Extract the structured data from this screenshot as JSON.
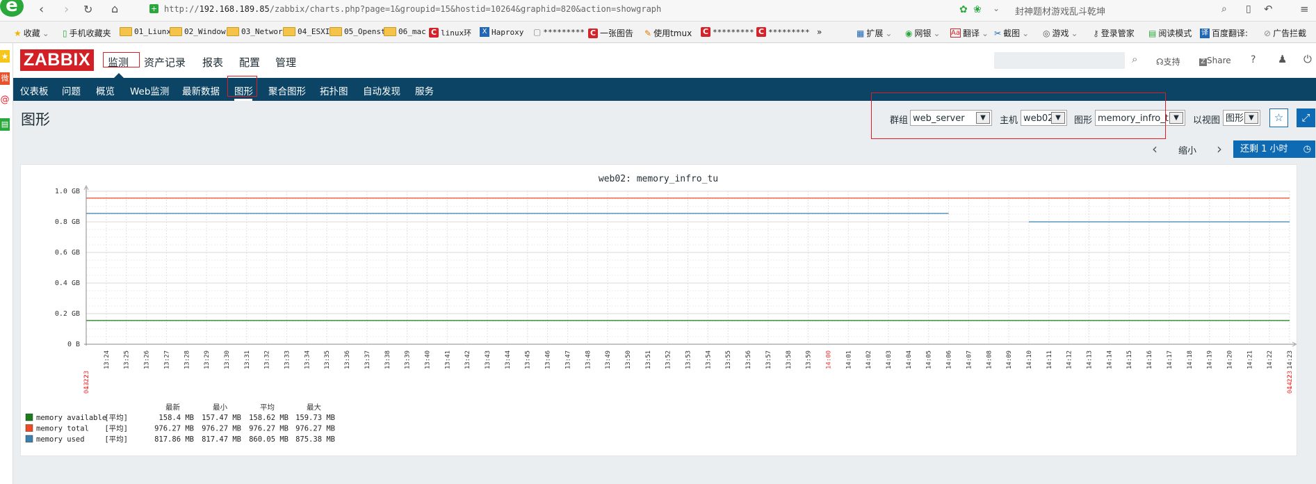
{
  "browser": {
    "url_prefix": "http://",
    "url_host": "192.168.189.85",
    "url_path": "/zabbix/charts.php?page=1&groupid=15&hostid=10264&graphid=820&action=showgraph",
    "search_hint": "封神题材游戏乱斗乾坤",
    "bookmarks": [
      "收藏",
      "手机收藏夹",
      "01_Liunx",
      "02_Window",
      "03_Networ",
      "04_ESXI",
      "05_Openst",
      "06_mac",
      "linux环",
      "Haproxy",
      "*********",
      "一张图告",
      "使用tmux",
      "*********",
      "*********",
      "»"
    ],
    "right_tools": [
      "扩展",
      "网银",
      "翻译",
      "截图",
      "游戏",
      "登录管家",
      "阅读模式",
      "百度翻译:",
      "广告拦截"
    ]
  },
  "header": {
    "logo": "ZABBIX",
    "menu": [
      "监测",
      "资产记录",
      "报表",
      "配置",
      "管理"
    ],
    "support": "支持",
    "share": "Share",
    "help": "?"
  },
  "subnav": [
    "仪表板",
    "问题",
    "概览",
    "Web监测",
    "最新数据",
    "图形",
    "聚合图形",
    "拓扑图",
    "自动发现",
    "服务"
  ],
  "page": {
    "title": "图形",
    "filters": {
      "group_label": "群组",
      "group_value": "web_server",
      "host_label": "主机",
      "host_value": "web02",
      "graph_label": "图形",
      "graph_value": "memory_infro_tu",
      "view_label": "以视图",
      "view_value": "图形"
    }
  },
  "timebar": {
    "zoom_out": "缩小",
    "range_button": "还剩 1 小时"
  },
  "chart_data": {
    "type": "line",
    "title": "web02: memory_infro_tu",
    "ylabel": "",
    "xlabel": "",
    "ylim": [
      0,
      1.0
    ],
    "yticks": [
      "0 B",
      "0.2 GB",
      "0.4 GB",
      "0.6 GB",
      "0.8 GB",
      "1.0 GB"
    ],
    "ytick_values": [
      0,
      0.2,
      0.4,
      0.6,
      0.8,
      1.0
    ],
    "x_start": "13:23",
    "x_end": "14:23",
    "x_date": "04-22",
    "x_ticks": [
      "13:24",
      "13:25",
      "13:26",
      "13:27",
      "13:28",
      "13:29",
      "13:30",
      "13:31",
      "13:32",
      "13:33",
      "13:34",
      "13:35",
      "13:36",
      "13:37",
      "13:38",
      "13:39",
      "13:40",
      "13:41",
      "13:42",
      "13:43",
      "13:44",
      "13:45",
      "13:46",
      "13:47",
      "13:48",
      "13:49",
      "13:50",
      "13:51",
      "13:52",
      "13:53",
      "13:54",
      "13:55",
      "13:56",
      "13:57",
      "13:58",
      "13:59",
      "14:00",
      "14:01",
      "14:02",
      "14:03",
      "14:04",
      "14:05",
      "14:06",
      "14:07",
      "14:08",
      "14:09",
      "14:10",
      "14:11",
      "14:12",
      "14:13",
      "14:14",
      "14:15",
      "14:16",
      "14:17",
      "14:18",
      "14:19",
      "14:20",
      "14:21",
      "14:22",
      "14:23"
    ],
    "series": [
      {
        "name": "memory available",
        "color": "#1a7c1a",
        "segments": [
          {
            "x": [
              "13:23",
              "14:23"
            ],
            "y": [
              0.155,
              0.155
            ]
          }
        ]
      },
      {
        "name": "memory total",
        "color": "#f04a25",
        "segments": [
          {
            "x": [
              "13:23",
              "14:23"
            ],
            "y": [
              0.955,
              0.955
            ]
          }
        ]
      },
      {
        "name": "memory used",
        "color": "#3b81b0",
        "segments": [
          {
            "x": [
              "13:23",
              "14:06"
            ],
            "y": [
              0.855,
              0.855
            ]
          },
          {
            "x": [
              "14:10",
              "14:23"
            ],
            "y": [
              0.8,
              0.8
            ]
          }
        ]
      }
    ],
    "legend": {
      "headers": [
        "最新",
        "最小",
        "平均",
        "最大"
      ],
      "rows": [
        {
          "name": "memory available",
          "func": "[平均]",
          "values": [
            "158.4 MB",
            "157.47 MB",
            "158.62 MB",
            "159.73 MB"
          ]
        },
        {
          "name": "memory total",
          "func": "[平均]",
          "values": [
            "976.27 MB",
            "976.27 MB",
            "976.27 MB",
            "976.27 MB"
          ]
        },
        {
          "name": "memory used",
          "func": "[平均]",
          "values": [
            "817.86 MB",
            "817.47 MB",
            "860.05 MB",
            "875.38 MB"
          ]
        }
      ]
    }
  }
}
